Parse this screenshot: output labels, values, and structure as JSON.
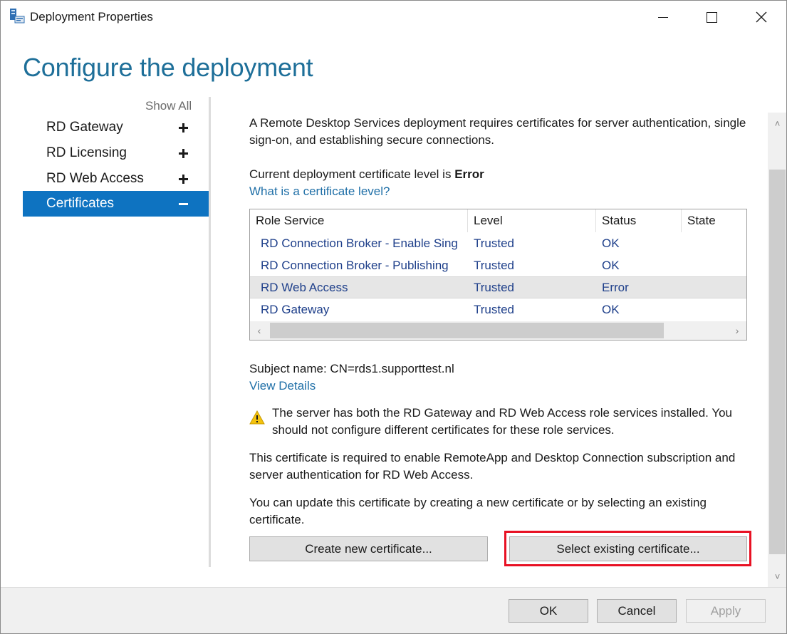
{
  "window": {
    "title": "Deployment Properties",
    "app_icon": "server-properties-icon",
    "controls": {
      "minimize": "minimize-icon",
      "maximize": "maximize-icon",
      "close": "close-icon"
    }
  },
  "page": {
    "title": "Configure the deployment"
  },
  "nav": {
    "show_all": "Show All",
    "items": [
      {
        "label": "RD Gateway",
        "state": "collapsed",
        "active": false
      },
      {
        "label": "RD Licensing",
        "state": "collapsed",
        "active": false
      },
      {
        "label": "RD Web Access",
        "state": "collapsed",
        "active": false
      },
      {
        "label": "Certificates",
        "state": "expanded",
        "active": true
      }
    ]
  },
  "content": {
    "intro": "A Remote Desktop Services deployment requires certificates for server authentication, single sign-on, and establishing secure connections.",
    "level_prefix": "Current deployment certificate level is ",
    "level_value": "Error",
    "level_link": "What is a certificate level?",
    "table": {
      "columns": [
        "Role Service",
        "Level",
        "Status",
        "State"
      ],
      "rows": [
        {
          "role": "RD Connection Broker - Enable Sing",
          "level": "Trusted",
          "status": "OK",
          "state": "",
          "selected": false
        },
        {
          "role": "RD Connection Broker - Publishing",
          "level": "Trusted",
          "status": "OK",
          "state": "",
          "selected": false
        },
        {
          "role": "RD Web Access",
          "level": "Trusted",
          "status": "Error",
          "state": "",
          "selected": true
        },
        {
          "role": "RD Gateway",
          "level": "Trusted",
          "status": "OK",
          "state": "",
          "selected": false
        }
      ]
    },
    "subject_label": "Subject name: ",
    "subject_value": "CN=rds1.supporttest.nl",
    "view_details": "View Details",
    "warning_icon": "warning-icon",
    "warning_text": "The server has both the RD Gateway and RD Web Access role services installed. You should not configure different certificates for these role services.",
    "required_text": "This certificate is required to enable RemoteApp and Desktop Connection subscription and server authentication for RD Web Access.",
    "update_text": "You can update this certificate by creating a new certificate or by selecting an existing certificate.",
    "create_button": "Create new certificate...",
    "select_button": "Select existing certificate...",
    "highlight_color": "#e81123",
    "accent_color": "#0e73c1"
  },
  "footer": {
    "ok": "OK",
    "cancel": "Cancel",
    "apply": "Apply"
  }
}
